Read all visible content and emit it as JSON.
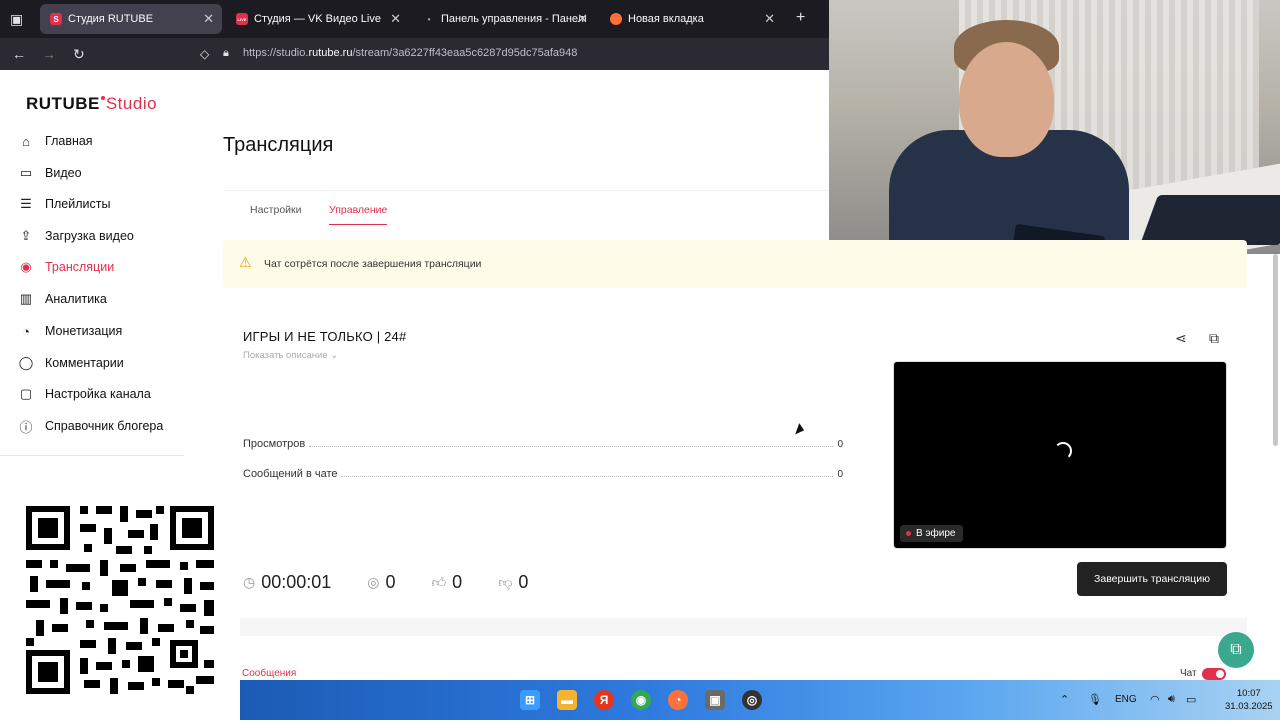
{
  "browser": {
    "tabs": [
      {
        "label": "Студия RUTUBE",
        "favicon_color": "#e1304c",
        "favicon_text": "S",
        "active": true
      },
      {
        "label": "Студия — VK Видео Live",
        "favicon_color": "#e1304c",
        "favicon_text": "LIVE",
        "active": false
      },
      {
        "label": "Панель управления - Панель у",
        "favicon_color": "#8a8a8a",
        "favicon_text": "•",
        "active": false
      },
      {
        "label": "Новая вкладка",
        "favicon_color": "#ff7139",
        "favicon_text": "",
        "active": false
      }
    ],
    "new_tab_glyph": "+",
    "url_prefix": "https://studio.",
    "url_domain": "rutube.ru",
    "url_path": "/stream/3a6227ff43eaa5c6287d95dc75afa948"
  },
  "sidebar": {
    "logo_main": "RUTUBE",
    "logo_sub": "Studio",
    "items": [
      {
        "label": "Главная",
        "icon": "home-icon",
        "glyph": "⌂",
        "active": false
      },
      {
        "label": "Видео",
        "icon": "video-icon",
        "glyph": "▭",
        "active": false
      },
      {
        "label": "Плейлисты",
        "icon": "playlist-icon",
        "glyph": "☰",
        "active": false
      },
      {
        "label": "Загрузка видео",
        "icon": "upload-icon",
        "glyph": "⇪",
        "active": false
      },
      {
        "label": "Трансляции",
        "icon": "broadcast-icon",
        "glyph": "◉",
        "active": true
      },
      {
        "label": "Аналитика",
        "icon": "analytics-icon",
        "glyph": "▥",
        "active": false
      },
      {
        "label": "Монетизация",
        "icon": "monetization-icon",
        "glyph": "◔",
        "active": false
      },
      {
        "label": "Комментарии",
        "icon": "comments-icon",
        "glyph": "◯",
        "active": false
      },
      {
        "label": "Настройка канала",
        "icon": "channel-settings-icon",
        "glyph": "▢",
        "active": false
      },
      {
        "label": "Справочник блогера",
        "icon": "handbook-icon",
        "glyph": "ⓘ",
        "active": false
      }
    ]
  },
  "main": {
    "title": "Трансляция",
    "tabs": [
      {
        "label": "Настройки",
        "active": false
      },
      {
        "label": "Управление",
        "active": true
      }
    ],
    "notice": "Чат сотрётся после завершения трансляции",
    "stream": {
      "title": "ИГРЫ И НЕ ТОЛЬКО | 24#",
      "show_description": "Показать описание",
      "stats": [
        {
          "label": "Просмотров",
          "value": "0"
        },
        {
          "label": "Сообщений в чате",
          "value": "0"
        }
      ],
      "live_badge": "В эфире",
      "timer": "00:00:01",
      "viewers": "0",
      "likes": "0",
      "dislikes": "0",
      "end_button": "Завершить трансляцию"
    },
    "messages_label": "Сообщения",
    "chat_label": "Чат",
    "chat_enabled": true
  },
  "taskbar": {
    "lang": "ENG",
    "time": "10:07",
    "date": "31.03.2025"
  },
  "colors": {
    "accent": "#e1304c",
    "notice_bg": "#fefbe8",
    "taskbar": "#2f7be0"
  }
}
